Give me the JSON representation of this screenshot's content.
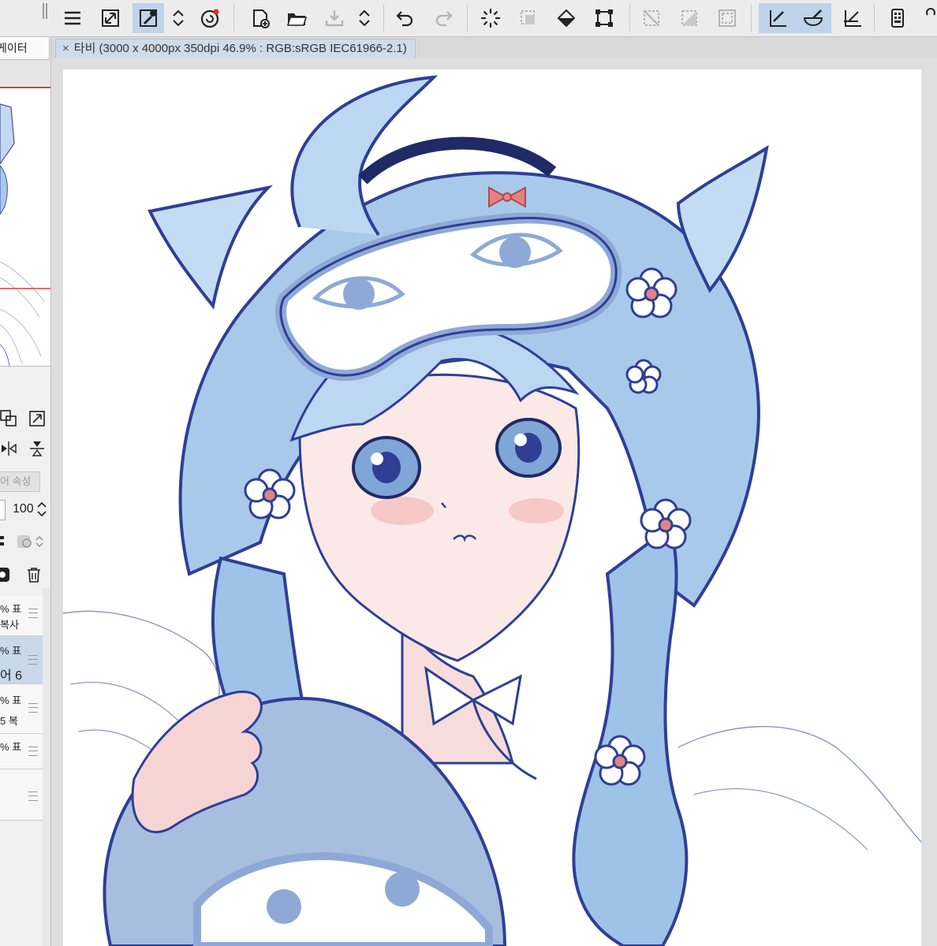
{
  "toolbar": {
    "buttons": [
      {
        "name": "menu-icon",
        "active": false
      },
      {
        "name": "fit-canvas-icon",
        "active": false
      },
      {
        "name": "eyedropper-icon",
        "active": true
      },
      {
        "name": "updown-arrows-icon",
        "active": false
      },
      {
        "name": "spiral-app-icon",
        "active": false
      },
      {
        "name": "new-canvas-icon",
        "active": false
      },
      {
        "name": "open-folder-icon",
        "active": false
      },
      {
        "name": "save-icon",
        "active": false
      },
      {
        "name": "updown-arrows-icon",
        "active": false
      },
      {
        "name": "undo-icon",
        "active": false
      },
      {
        "name": "redo-icon",
        "active": false
      },
      {
        "name": "loading-spinner-icon",
        "active": false
      },
      {
        "name": "select-dotted-icon",
        "active": false
      },
      {
        "name": "fill-bucket-icon",
        "active": false
      },
      {
        "name": "transform-icon",
        "active": false
      },
      {
        "name": "clear-selection-icon",
        "active": false
      },
      {
        "name": "invert-selection-icon",
        "active": false
      },
      {
        "name": "selection-border-icon",
        "active": false
      },
      {
        "name": "ruler-pen-icon",
        "active": true
      },
      {
        "name": "brush-bowl-icon",
        "active": true
      },
      {
        "name": "perspective-ruler-icon",
        "active": false
      },
      {
        "name": "device-icon",
        "active": false
      }
    ]
  },
  "sidebar": {
    "tab_label": "게이터",
    "property_tab": "어 속성",
    "opacity_value": "100",
    "layers": [
      {
        "line1": "% 표",
        "line2": "복사",
        "selected": false
      },
      {
        "line1": "% 표",
        "line2": "어 6",
        "selected": true
      },
      {
        "line1": "% 표",
        "line2": "5 복",
        "selected": false
      },
      {
        "line1": "% 표",
        "line2": "",
        "selected": false
      },
      {
        "line1": "",
        "line2": "",
        "selected": false
      }
    ]
  },
  "document": {
    "tab_title": "타비 (3000 x 4000px 350dpi 46.9% : RGB:sRGB IEC61966-2.1)",
    "close_symbol": "×"
  },
  "colors": {
    "line_art": "#2e3f95",
    "hair_blue": "#a9c9ea",
    "hair_light": "#d6e7f7",
    "mask_blue": "#8ea9d6",
    "bow_pink": "#e48282",
    "skin": "#fbe9e7",
    "blush": "#f5bfc1",
    "selection_blue": "#bfd3ea"
  }
}
